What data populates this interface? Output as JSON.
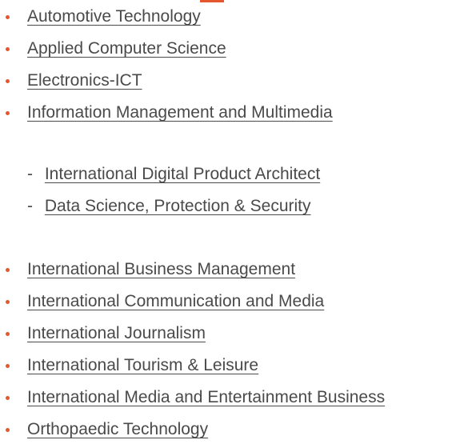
{
  "list_top": [
    "Automotive Technology",
    "Applied Computer Science ",
    "Electronics-ICT",
    "Information Management and Multimedia"
  ],
  "sub_list": {
    "dash": "-",
    "items": [
      "International Digital Product Architect",
      "Data Science, Protection & Security"
    ]
  },
  "list_bottom": [
    "International Business Management ",
    "International Communication and Media ",
    "International Journalism",
    "International Tourism & Leisure",
    "International Media and Entertainment Business",
    "Orthopaedic Technology "
  ],
  "colors": {
    "bullet": "#e4572e",
    "text": "#4a4a4a"
  }
}
